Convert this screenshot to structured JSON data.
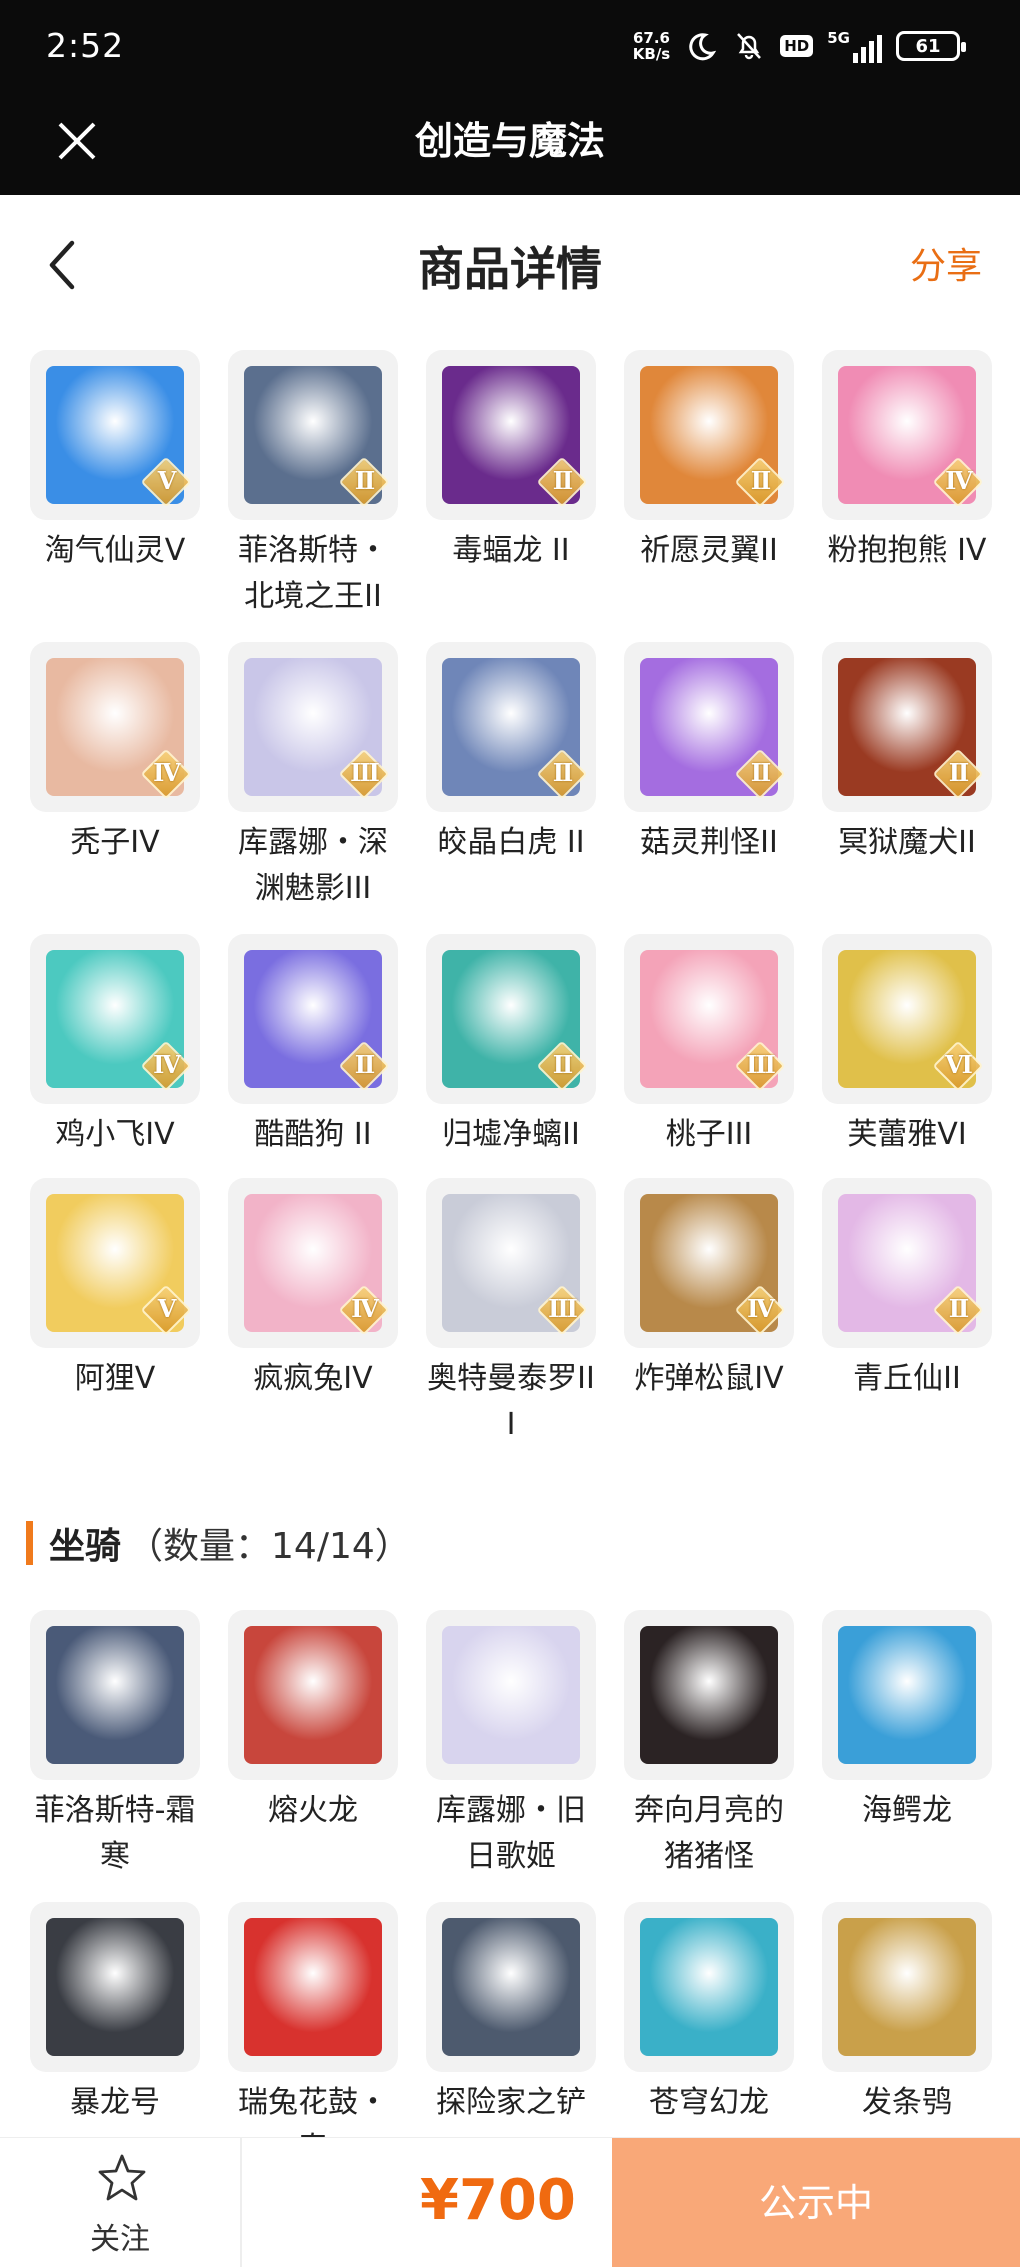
{
  "status_bar": {
    "time": "2:52",
    "net_speed_value": "67.6",
    "net_speed_unit": "KB/s",
    "hd": "HD",
    "signal": "5G",
    "battery": "61"
  },
  "app_bar": {
    "title": "创造与魔法"
  },
  "header": {
    "title": "商品详情",
    "share_label": "分享"
  },
  "pets": [
    {
      "name": "淘气仙灵V",
      "tier": "V",
      "icon": "blue-puppy-pet",
      "color": "#3a8ee6"
    },
    {
      "name": "菲洛斯特・北境之王II",
      "tier": "II",
      "icon": "ice-armored-king-pet",
      "color": "#5b6f8e"
    },
    {
      "name": "毒蝠龙 II",
      "tier": "II",
      "icon": "purple-bat-dragon-pet",
      "color": "#6a2b8c"
    },
    {
      "name": "祈愿灵翼II",
      "tier": "II",
      "icon": "phoenix-bird-pet",
      "color": "#e0873a"
    },
    {
      "name": "粉抱抱熊 IV",
      "tier": "IV",
      "icon": "pink-bear-pet",
      "color": "#f08cb4"
    },
    {
      "name": "秃子IV",
      "tier": "IV",
      "icon": "bald-boy-pet",
      "color": "#e8b9a1"
    },
    {
      "name": "库露娜・深渊魅影III",
      "tier": "III",
      "icon": "white-haired-girl-pet",
      "color": "#c9c6e8"
    },
    {
      "name": "皎晶白虎 II",
      "tier": "II",
      "icon": "white-tiger-pet",
      "color": "#6f86b8"
    },
    {
      "name": "菇灵荆怪II",
      "tier": "II",
      "icon": "mushroom-girl-pet",
      "color": "#a46de0"
    },
    {
      "name": "冥狱魔犬II",
      "tier": "II",
      "icon": "hell-hound-pet",
      "color": "#9a3a22"
    },
    {
      "name": "鸡小飞IV",
      "tier": "IV",
      "icon": "muscle-chick-pet",
      "color": "#4cc9c0"
    },
    {
      "name": "酷酷狗 II",
      "tier": "II",
      "icon": "goggle-dog-pet",
      "color": "#7a6ee0"
    },
    {
      "name": "归墟净螭II",
      "tier": "II",
      "icon": "teal-dragon-pet",
      "color": "#3fb3a8"
    },
    {
      "name": "桃子III",
      "tier": "III",
      "icon": "pink-cat-pet",
      "color": "#f4a3b8"
    },
    {
      "name": "芙蕾雅VI",
      "tier": "VI",
      "icon": "valkyrie-girl-pet",
      "color": "#e0c04a"
    },
    {
      "name": "阿狸V",
      "tier": "V",
      "icon": "lion-hat-bunny-pet",
      "color": "#f1cc5e"
    },
    {
      "name": "疯疯兔IV",
      "tier": "IV",
      "icon": "crazy-rabbit-pet",
      "color": "#f2b3c8"
    },
    {
      "name": "奥特曼泰罗III",
      "tier": "III",
      "icon": "ultraman-taro-pet",
      "color": "#c9ccd8"
    },
    {
      "name": "炸弹松鼠IV",
      "tier": "IV",
      "icon": "bomb-squirrel-pet",
      "color": "#b8894a"
    },
    {
      "name": "青丘仙II",
      "tier": "II",
      "icon": "fox-fairy-pet",
      "color": "#e3b8e6"
    }
  ],
  "mount_section": {
    "title": "坐骑",
    "count": "（数量：14/14）"
  },
  "mounts": [
    {
      "name": "菲洛斯特-霜寒",
      "icon": "frost-knight-mount",
      "color": "#4a5a78"
    },
    {
      "name": "熔火龙",
      "icon": "lava-dragon-mount",
      "color": "#c8463c"
    },
    {
      "name": "库露娜・旧日歌姬",
      "icon": "songstress-mount",
      "color": "#d8d4ee"
    },
    {
      "name": "奔向月亮的猪猪怪",
      "icon": "moon-pig-mount",
      "color": "#2b2324"
    },
    {
      "name": "海鳄龙",
      "icon": "sea-dragon-mount",
      "color": "#3a9fd8"
    },
    {
      "name": "暴龙号",
      "icon": "mecha-tyrant-mount",
      "color": "#3a3d44"
    },
    {
      "name": "瑞兔花鼓・春",
      "icon": "rabbit-drum-mount",
      "color": "#d8322e"
    },
    {
      "name": "探险家之铲",
      "icon": "explorer-shovel-mount",
      "color": "#4d5a6e"
    },
    {
      "name": "苍穹幻龙",
      "icon": "sky-dragon-mount",
      "color": "#3ab0c8"
    },
    {
      "name": "发条鸮",
      "icon": "clockwork-owl-mount",
      "color": "#c9a04a"
    }
  ],
  "bottom_bar": {
    "follow_label": "关注",
    "price": "¥700",
    "status_label": "公示中"
  },
  "colors": {
    "accent": "#e96e14",
    "status_button": "#f9a878",
    "header_bg": "#0b0b0b"
  }
}
